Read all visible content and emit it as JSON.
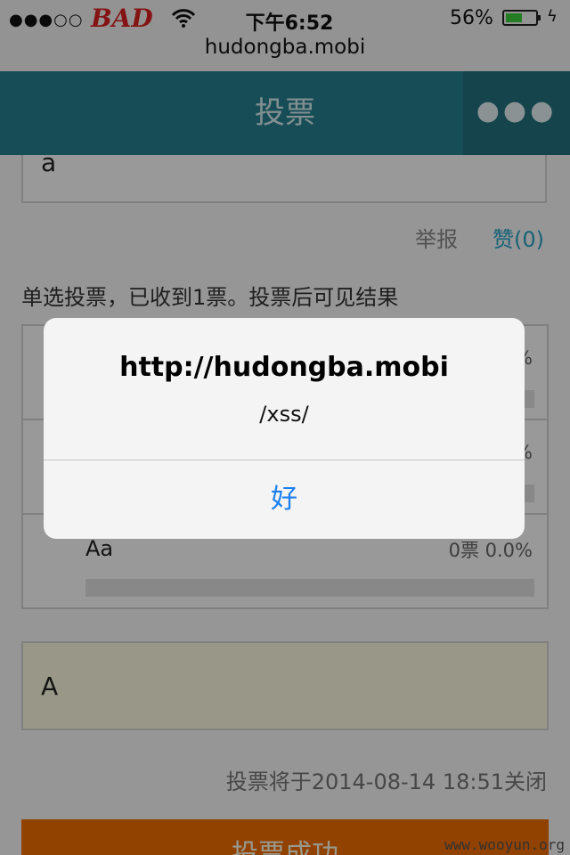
{
  "status_bar": {
    "signal": "●●●○○",
    "carrier": "BAD",
    "time": "下午6:52",
    "battery_percent": "56%",
    "battery_level": 0.56,
    "url": "hudongba.mobi"
  },
  "navbar": {
    "title": "投票",
    "more_label": "●●●"
  },
  "content": {
    "top_box_text": "a",
    "report_label": "举报",
    "like_label": "赞(0)",
    "vote_info": "单选投票，已收到1票。投票后可见结果",
    "options": [
      {
        "label": "",
        "stat": "%"
      },
      {
        "label": "",
        "stat": "%"
      },
      {
        "label": "Aa",
        "stat": "0票  0.0%"
      }
    ],
    "answer_text": "A",
    "close_info": "投票将于2014-08-14 18:51关闭",
    "vote_button_label": "投票成功"
  },
  "alert": {
    "title": "http://hudongba.mobi",
    "message": "/xss/",
    "ok_label": "好"
  },
  "watermark": "www.wooyun.org",
  "colors": {
    "navbar": "#27808f",
    "accent_link": "#27a3c7",
    "vote_button": "#f26d00",
    "alert_button": "#1b7ff0"
  }
}
